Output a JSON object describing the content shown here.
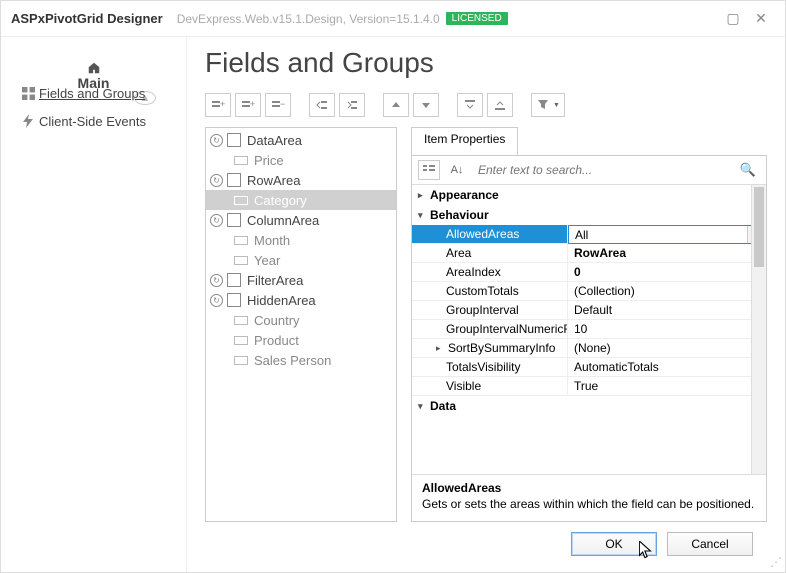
{
  "titlebar": {
    "title": "ASPxPivotGrid Designer",
    "subtitle": "DevExpress.Web.v15.1.Design, Version=15.1.4.0",
    "licensed": "LICENSED"
  },
  "sidebar": {
    "main": "Main",
    "fields_groups": "Fields and Groups",
    "client_events": "Client-Side Events"
  },
  "page_title": "Fields and Groups",
  "tree": {
    "areas": [
      {
        "name": "DataArea",
        "items": [
          "Price"
        ]
      },
      {
        "name": "RowArea",
        "items": [
          "Category"
        ]
      },
      {
        "name": "ColumnArea",
        "items": [
          "Month",
          "Year"
        ]
      },
      {
        "name": "FilterArea",
        "items": []
      },
      {
        "name": "HiddenArea",
        "items": [
          "Country",
          "Product",
          "Sales Person"
        ]
      }
    ],
    "selected": "Category"
  },
  "tab_label": "Item Properties",
  "search_placeholder": "Enter text to search...",
  "properties": {
    "categories": [
      {
        "name": "Appearance",
        "expanded": false
      },
      {
        "name": "Behaviour",
        "expanded": true,
        "rows": [
          {
            "name": "AllowedAreas",
            "value": "All",
            "selected": true,
            "dropdown": true
          },
          {
            "name": "Area",
            "value": "RowArea",
            "bold": true
          },
          {
            "name": "AreaIndex",
            "value": "0",
            "bold": true
          },
          {
            "name": "CustomTotals",
            "value": "(Collection)"
          },
          {
            "name": "GroupInterval",
            "value": "Default"
          },
          {
            "name": "GroupIntervalNumericRange",
            "value": "10",
            "clipped": "GroupIntervalNumericRan"
          },
          {
            "name": "SortBySummaryInfo",
            "value": "(None)",
            "expandable": true
          },
          {
            "name": "TotalsVisibility",
            "value": "AutomaticTotals"
          },
          {
            "name": "Visible",
            "value": "True"
          }
        ]
      },
      {
        "name": "Data",
        "expanded": true
      }
    ],
    "description": {
      "title": "AllowedAreas",
      "text": "Gets or sets the areas within which the field can be positioned."
    }
  },
  "footer": {
    "ok": "OK",
    "cancel": "Cancel"
  }
}
